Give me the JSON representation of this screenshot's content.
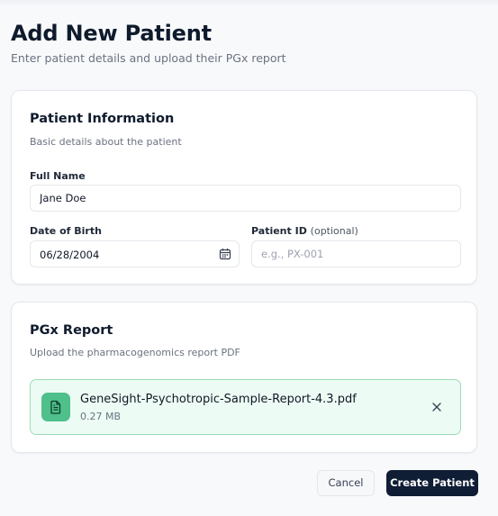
{
  "header": {
    "title": "Add New Patient",
    "subtitle": "Enter patient details and upload their PGx report"
  },
  "patient_info": {
    "title": "Patient Information",
    "description": "Basic details about the patient",
    "full_name": {
      "label": "Full Name",
      "value": "Jane Doe"
    },
    "date_of_birth": {
      "label": "Date of Birth",
      "value": "06/28/2004"
    },
    "patient_id": {
      "label": "Patient ID",
      "optional_hint": "(optional)",
      "value": "",
      "placeholder": "e.g., PX-001"
    }
  },
  "pgx_report": {
    "title": "PGx Report",
    "description": "Upload the pharmacogenomics report PDF",
    "file": {
      "name": "GeneSight-Psychotropic-Sample-Report-4.3.pdf",
      "size": "0.27 MB",
      "icon": "file-text-icon"
    }
  },
  "actions": {
    "cancel_label": "Cancel",
    "create_label": "Create Patient"
  },
  "colors": {
    "primary": "#0f1d35",
    "success_bg": "#ecfbf3",
    "success_border": "#9fdcb9",
    "file_icon": "#4fbf8b"
  }
}
